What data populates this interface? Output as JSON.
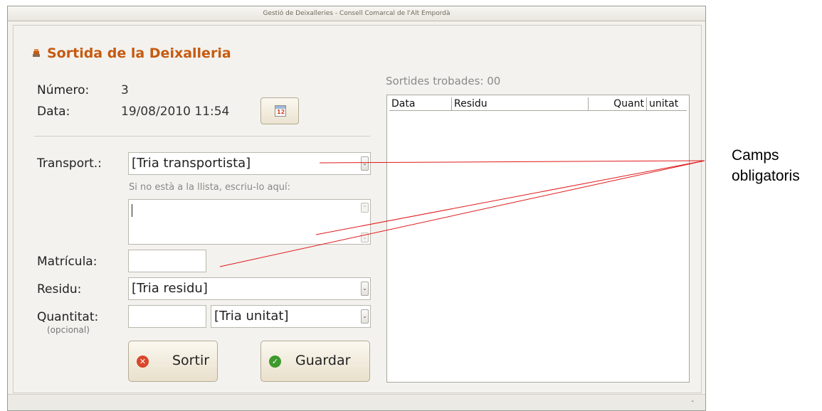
{
  "window": {
    "title": "Gestió de Deixalleries - Consell Comarcal de l'Alt Empordà",
    "status_text": "-"
  },
  "form": {
    "title": "Sortida de la Deixalleria",
    "title_icon": "stack-icon",
    "numero_label": "Número:",
    "numero_value": "3",
    "data_label": "Data:",
    "data_value": "19/08/2010 11:54",
    "calendar_icon_text": "12",
    "transport_label": "Transport.:",
    "transport_selected": "[Tria transportista]",
    "transport_hint": "Si no està a la llista, escriu-lo aquí:",
    "transport_text_value": "",
    "matricula_label": "Matrícula:",
    "matricula_value": "",
    "residu_label": "Residu:",
    "residu_selected": "[Tria residu]",
    "quantitat_label": "Quantitat:",
    "quantitat_hint": "(opcional)",
    "quantitat_value": "",
    "unitat_selected": "[Tria unitat]",
    "sortir_label": "Sortir",
    "guardar_label": "Guardar"
  },
  "results": {
    "label": "Sortides trobades: 00",
    "columns": [
      "Data",
      "Residu",
      "Quant",
      "unitat"
    ],
    "rows": []
  },
  "annotation": {
    "line1": "Camps",
    "line2": "obligatoris",
    "line_color": "#e0191b"
  },
  "colors": {
    "title": "#c65a10",
    "sortir_icon": "#d9472b",
    "guardar_icon": "#3d9a2c"
  }
}
